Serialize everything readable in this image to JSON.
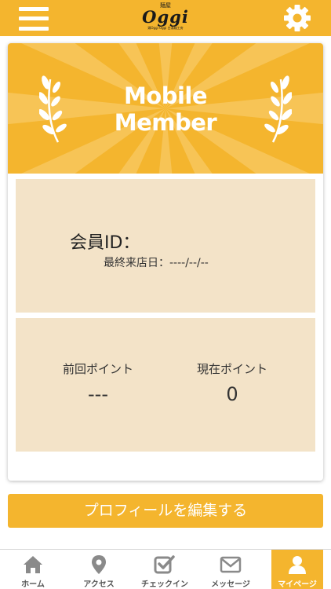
{
  "header": {
    "logo_top": "麺屋",
    "logo_main": "Oggi",
    "logo_sub": "鶏Oggi Oggi 白湯麺工房",
    "menu_icon": "hamburger-icon",
    "settings_icon": "gear-icon"
  },
  "hero": {
    "title_line1": "Mobile",
    "title_line2": "Member",
    "decoration_icon": "laurel-icon"
  },
  "member": {
    "id_label": "会員ID：",
    "last_visit": "最終来店日：----/--/--"
  },
  "points": {
    "previous_label": "前回ポイント",
    "previous_value": "---",
    "current_label": "現在ポイント",
    "current_value": "0"
  },
  "edit_profile_label": "プロフィールを編集する",
  "tabs": [
    {
      "label": "ホーム",
      "icon": "home-icon"
    },
    {
      "label": "アクセス",
      "icon": "map-pin-icon"
    },
    {
      "label": "チェックイン",
      "icon": "checkin-icon"
    },
    {
      "label": "メッセージ",
      "icon": "mail-icon"
    },
    {
      "label": "マイページ",
      "icon": "user-icon",
      "active": true
    }
  ],
  "colors": {
    "accent": "#f4b52e",
    "panel": "#f3e3c8",
    "tab_icon": "#8a8a8a"
  }
}
